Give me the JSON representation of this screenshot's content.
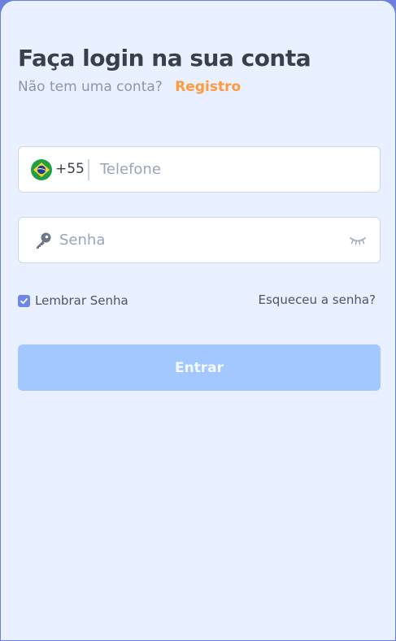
{
  "login": {
    "title": "Faça login na sua conta",
    "no_account_text": "Não tem uma conta?",
    "register_label": "Registro"
  },
  "phone_field": {
    "country_flag_icon": "brazil-flag-icon",
    "country_code": "+55",
    "placeholder": "Telefone",
    "value": ""
  },
  "password_field": {
    "icon": "key-icon",
    "placeholder": "Senha",
    "value": "",
    "visibility_icon": "eye-closed-icon"
  },
  "options": {
    "remember_label": "Lembrar Senha",
    "remember_checked": true,
    "forgot_label": "Esqueceu a senha?"
  },
  "submit": {
    "label": "Entrar"
  },
  "colors": {
    "background": "#e9f0ff",
    "accent_orange": "#ff9a3d",
    "checkbox": "#6f86e8",
    "button_disabled": "#a2c8ff",
    "title_text": "#3a3f4a"
  }
}
